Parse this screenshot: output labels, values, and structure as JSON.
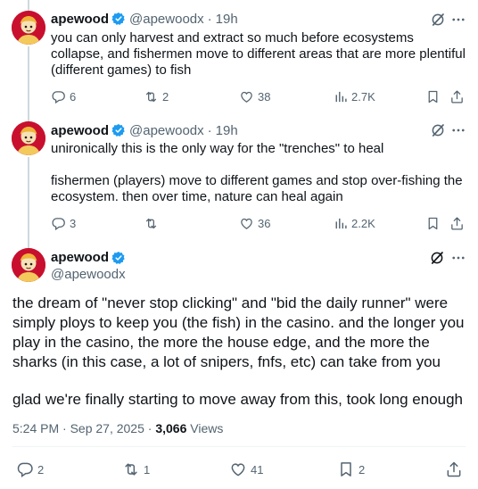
{
  "author": {
    "display_name": "apewood",
    "handle": "@apewoodx"
  },
  "tweets": [
    {
      "time": "19h",
      "paragraphs": [
        "you can only harvest and extract so much before ecosystems collapse, and fishermen move to different areas that are more plentiful (different games) to fish"
      ],
      "replies": "6",
      "reposts": "2",
      "likes": "38",
      "views": "2.7K"
    },
    {
      "time": "19h",
      "paragraphs": [
        "unironically this is the only way for the \"trenches\" to heal",
        "fishermen (players) move to different games and stop over-fishing the ecosystem. then over time, nature can heal again"
      ],
      "replies": "3",
      "reposts": "",
      "likes": "36",
      "views": "2.2K"
    }
  ],
  "main_tweet": {
    "paragraphs": [
      "the dream of \"never stop clicking\" and \"bid the daily runner\" were simply ploys to keep you (the fish) in the casino. and the longer you play in the casino, the more the house edge, and the more the sharks (in this case, a lot of snipers, fnfs, etc) can take from you",
      "glad we're finally starting to move away from this, took long enough"
    ],
    "timestamp": "5:24 PM · Sep 27, 2025 · ",
    "views_count": "3,066",
    "views_label": " Views",
    "replies": "2",
    "reposts": "1",
    "likes": "41",
    "bookmarks": "2"
  },
  "separator": "·",
  "colors": {
    "accent": "#1d9bf0",
    "text": "#0f1419",
    "muted": "#536471",
    "avatar_bg": "#c8102e"
  },
  "icons": [
    "verified-badge-icon",
    "grok-icon",
    "more-icon",
    "reply-icon",
    "repost-icon",
    "like-icon",
    "views-icon",
    "bookmark-icon",
    "share-icon"
  ]
}
